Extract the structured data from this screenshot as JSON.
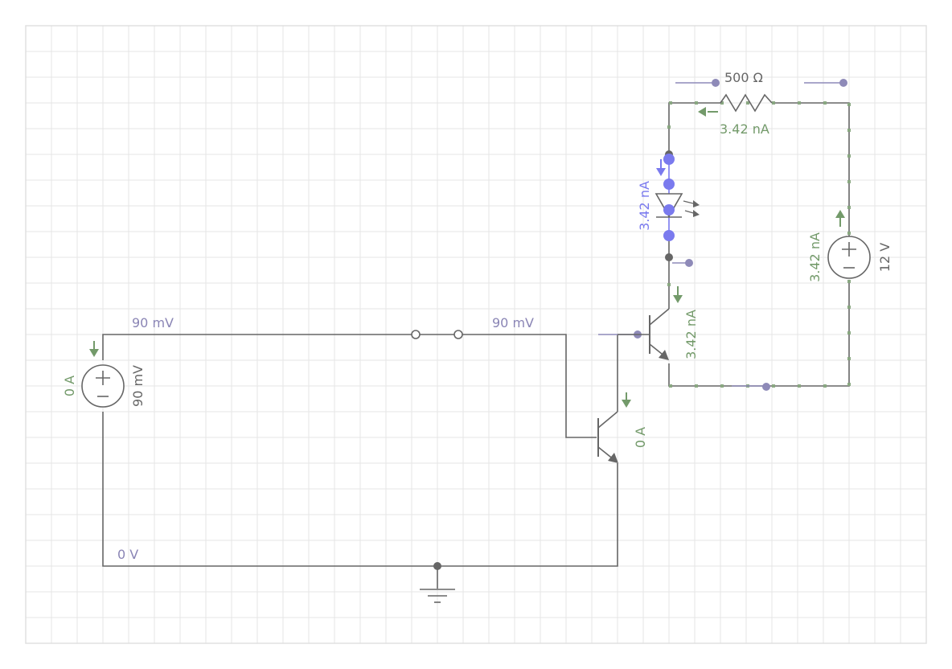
{
  "diagram": {
    "type": "circuit-schematic",
    "colors": {
      "grid": "#e6e6e6",
      "wire": "#666666",
      "current": "#739a6a",
      "voltage_label": "#8a85b5",
      "probe": "#8e8ab8",
      "led_node": "#7a7aee"
    },
    "labels": {
      "source_left_current": "0 A",
      "source_left_voltage": "90 mV",
      "node_left_voltage": "90 mV",
      "node_mid_voltage": "90 mV",
      "ground_voltage": "0 V",
      "lower_transistor_current": "0 A",
      "upper_transistor_current": "3.42 nA",
      "led_current": "3.42 nA",
      "resistor_value": "500 Ω",
      "resistor_current": "3.42 nA",
      "source_right_current": "3.42 nA",
      "source_right_voltage": "12 V"
    },
    "components": [
      {
        "kind": "voltage-source",
        "icon": "plus-minus-icon"
      },
      {
        "kind": "switch",
        "state": "open"
      },
      {
        "kind": "npn-transistor"
      },
      {
        "kind": "npn-transistor"
      },
      {
        "kind": "led",
        "icon": "light-emission-icon"
      },
      {
        "kind": "resistor"
      },
      {
        "kind": "voltage-source",
        "icon": "plus-minus-icon"
      },
      {
        "kind": "ground",
        "icon": "ground-icon"
      }
    ]
  }
}
